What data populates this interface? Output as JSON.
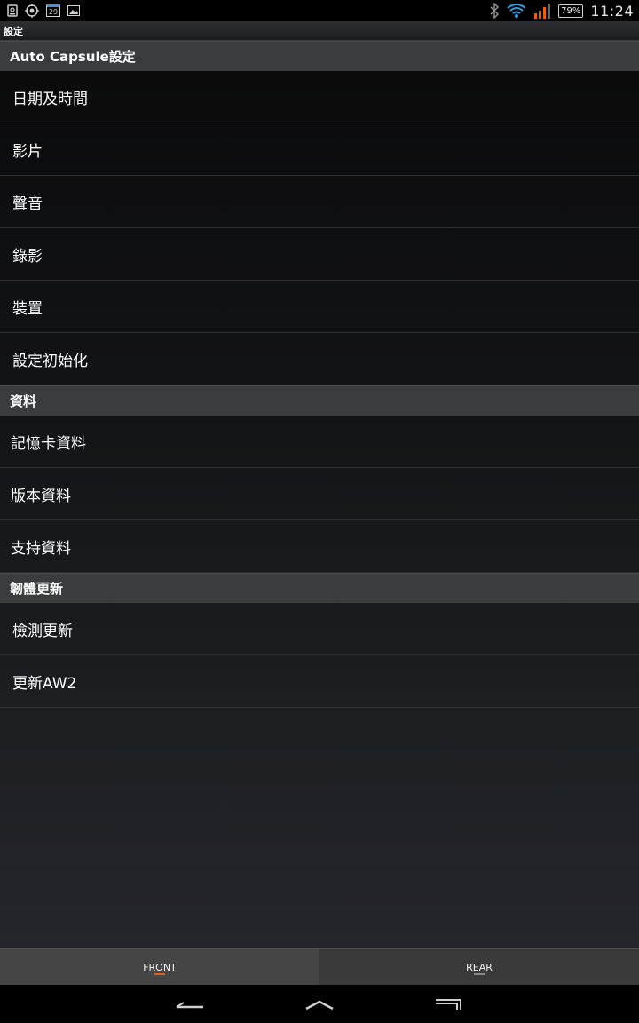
{
  "status_bar": {
    "time": "11:24",
    "battery": "79%",
    "calendar_day": "29",
    "left_icons": [
      "sim-icon",
      "location-icon",
      "calendar-icon",
      "image-icon"
    ],
    "right_icons": [
      "bluetooth-icon",
      "wifi-icon",
      "signal-icon"
    ]
  },
  "title": "設定",
  "sections": [
    {
      "header": "Auto Capsule設定",
      "items": [
        "日期及時間",
        "影片",
        "聲音",
        "錄影",
        "裝置",
        "設定初始化"
      ]
    },
    {
      "header": "資料",
      "items": [
        "記憶卡資料",
        "版本資料",
        "支持資料"
      ]
    },
    {
      "header": "韌體更新",
      "items": [
        "檢測更新",
        "更新AW2"
      ]
    }
  ],
  "tabs": [
    {
      "label": "FRONT",
      "active": true
    },
    {
      "label": "REAR",
      "active": false
    }
  ],
  "colors": {
    "accent": "#e0601c",
    "section_header_bg": "#3b3c3d"
  }
}
